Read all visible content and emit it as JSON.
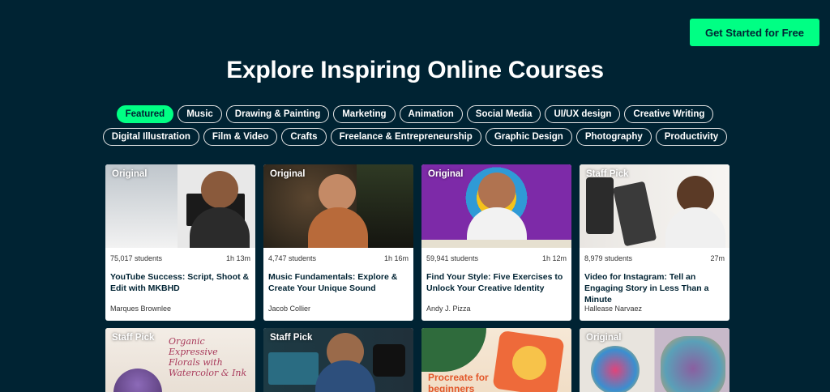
{
  "header": {
    "cta_label": "Get Started for Free"
  },
  "page": {
    "title": "Explore Inspiring Online Courses"
  },
  "categories_row1": [
    "Featured",
    "Music",
    "Drawing & Painting",
    "Marketing",
    "Animation",
    "Social Media",
    "UI/UX design",
    "Creative Writing"
  ],
  "categories_row2": [
    "Digital Illustration",
    "Film & Video",
    "Crafts",
    "Freelance & Entrepreneurship",
    "Graphic Design",
    "Photography",
    "Productivity"
  ],
  "active_category": "Featured",
  "courses": [
    {
      "badge": "Original",
      "students": "75,017 students",
      "duration": "1h 13m",
      "title": "YouTube Success: Script, Shoot & Edit with MKBHD",
      "author": "Marques Brownlee"
    },
    {
      "badge": "Original",
      "students": "4,747 students",
      "duration": "1h 16m",
      "title": "Music Fundamentals: Explore & Create Your Unique Sound",
      "author": "Jacob Collier"
    },
    {
      "badge": "Original",
      "students": "59,941 students",
      "duration": "1h 12m",
      "title": "Find Your Style: Five Exercises to Unlock Your Creative Identity",
      "author": "Andy J. Pizza"
    },
    {
      "badge": "Staff Pick",
      "students": "8,979 students",
      "duration": "27m",
      "title": "Video for Instagram: Tell an Engaging Story in Less Than a Minute",
      "author": "Hallease Narvaez"
    },
    {
      "badge": "Staff Pick",
      "thumb_text": "Organic Expressive Florals with Watercolor & Ink"
    },
    {
      "badge": "Staff Pick"
    },
    {
      "badge": "",
      "thumb_text": "Procreate for beginners"
    },
    {
      "badge": "Original"
    }
  ],
  "colors": {
    "background": "#002333",
    "accent": "#00ff84",
    "card": "#ffffff"
  }
}
